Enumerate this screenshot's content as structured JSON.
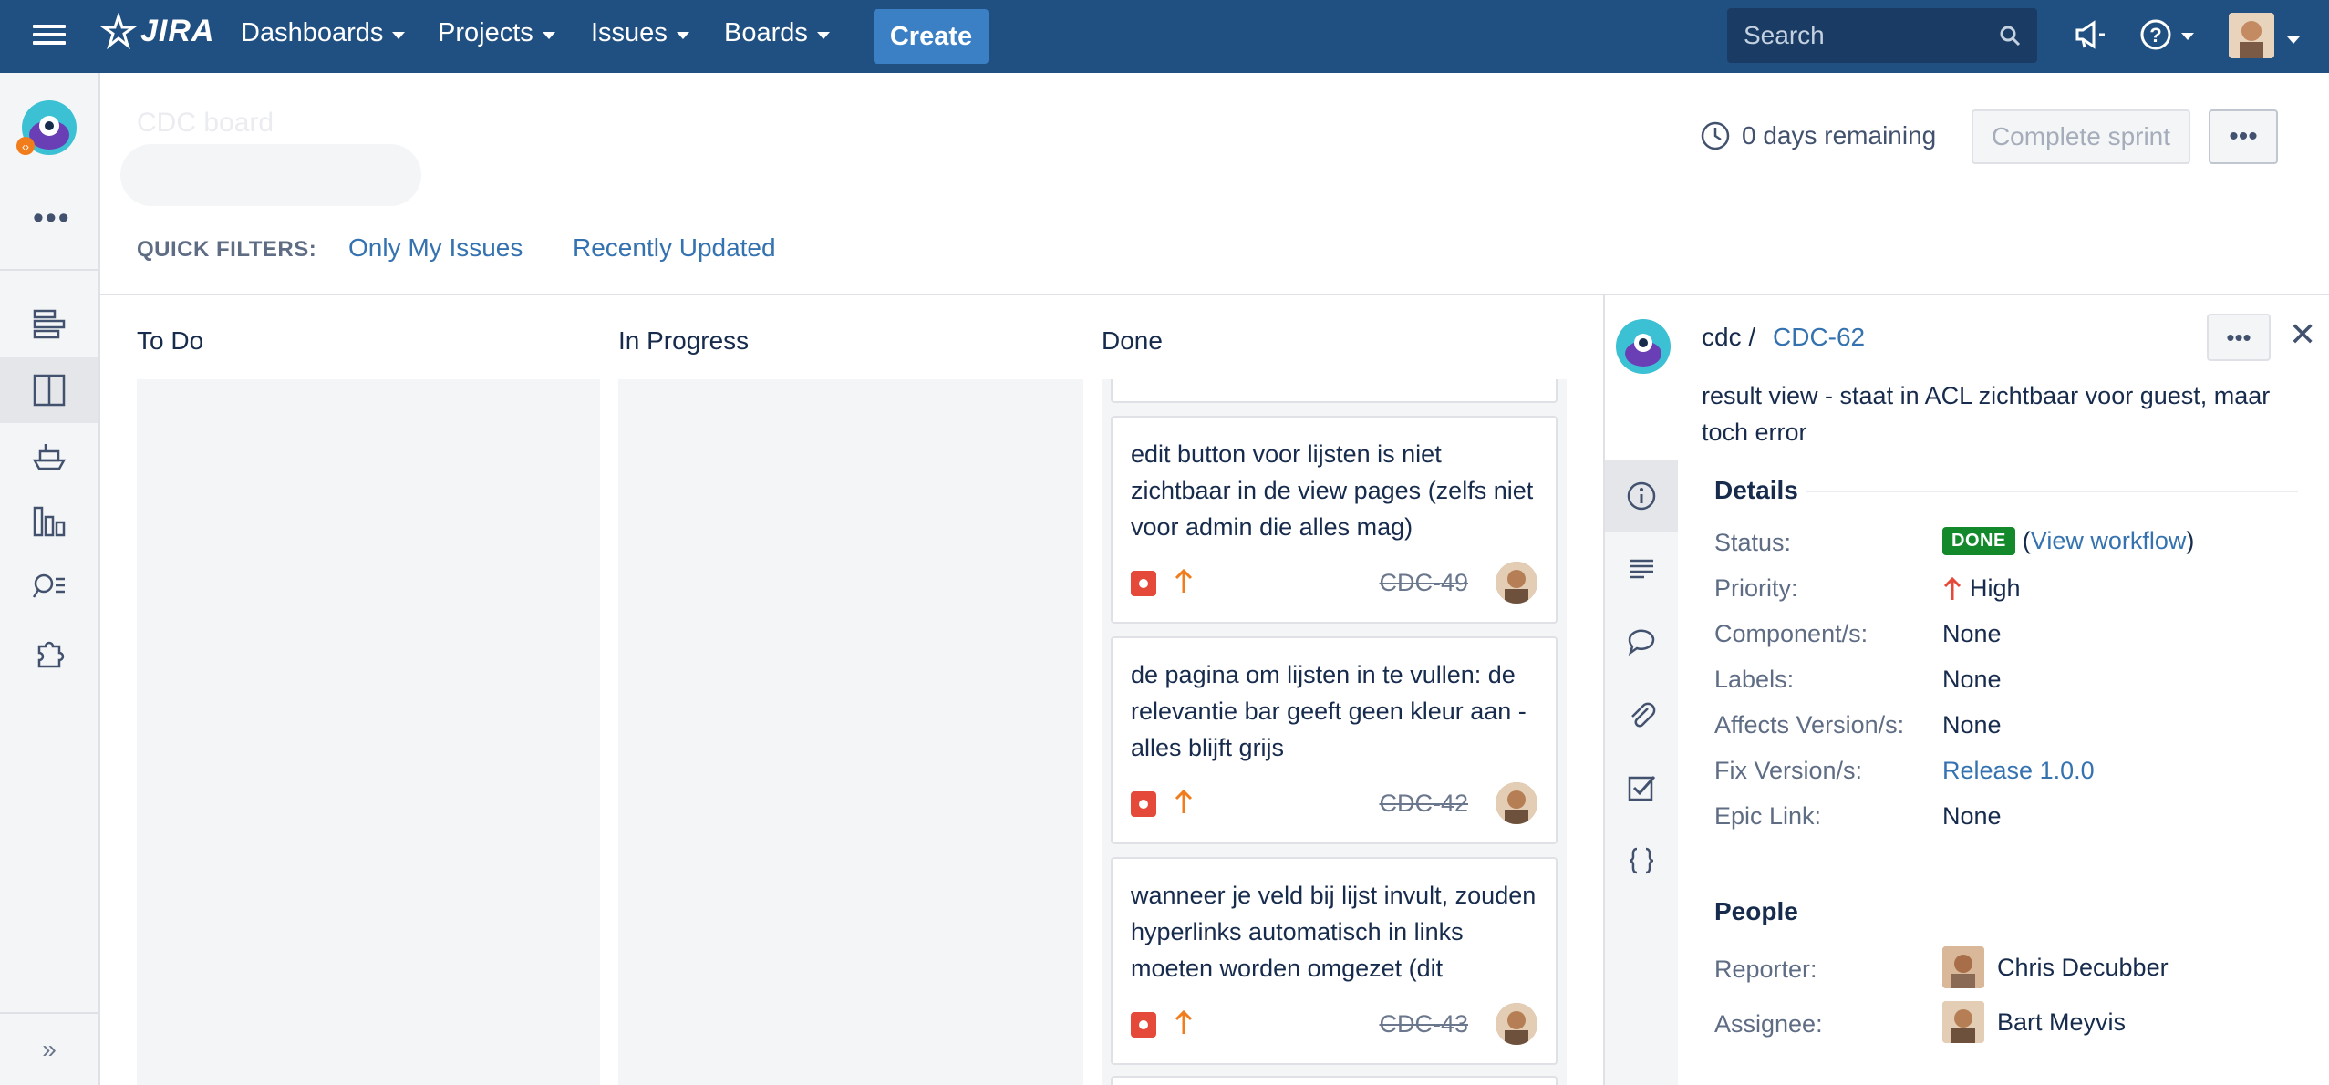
{
  "nav": {
    "logo": "JIRA",
    "items": [
      {
        "label": "Dashboards"
      },
      {
        "label": "Projects"
      },
      {
        "label": "Issues"
      },
      {
        "label": "Boards"
      }
    ],
    "create_label": "Create",
    "search_placeholder": "Search"
  },
  "board": {
    "title": "CDC board",
    "days_remaining": "0 days remaining",
    "complete_sprint": "Complete sprint",
    "quick_filters_label": "QUICK FILTERS:",
    "quick_filters": [
      "Only My Issues",
      "Recently Updated"
    ]
  },
  "columns": [
    "To Do",
    "In Progress",
    "Done"
  ],
  "cards": [
    {
      "summary": "edit button voor lijsten is niet zichtbaar in de view pages (zelfs niet voor admin die alles mag)",
      "key": "CDC-49"
    },
    {
      "summary": "de pagina om lijsten in te vullen: de relevantie bar geeft geen kleur aan - alles blijft grijs",
      "key": "CDC-42"
    },
    {
      "summary": "wanneer je veld bij lijst invult, zouden hyperlinks automatisch in links moeten worden omgezet (dit",
      "key": "CDC-43"
    }
  ],
  "detail": {
    "project": "cdc /",
    "key": "CDC-62",
    "summary": "result view - staat in ACL zichtbaar voor guest, maar toch error",
    "details_title": "Details",
    "fields": {
      "status_label": "Status:",
      "status_value": "DONE",
      "view_workflow": "View workflow",
      "priority_label": "Priority:",
      "priority_value": "High",
      "components_label": "Component/s:",
      "components_value": "None",
      "labels_label": "Labels:",
      "labels_value": "None",
      "affects_label": "Affects Version/s:",
      "affects_value": "None",
      "fix_label": "Fix Version/s:",
      "fix_value": "Release 1.0.0",
      "epic_label": "Epic Link:",
      "epic_value": "None"
    },
    "people_title": "People",
    "reporter_label": "Reporter:",
    "reporter_value": "Chris Decubber",
    "assignee_label": "Assignee:",
    "assignee_value": "Bart Meyvis"
  },
  "colors": {
    "nav_bg": "#205081",
    "create_bg": "#3b7fc4",
    "link": "#3572b0",
    "done_lozenge": "#14892c",
    "bug": "#e5493a",
    "priority_high_card": "#f07c1c",
    "priority_high_detail": "#e5493a"
  }
}
